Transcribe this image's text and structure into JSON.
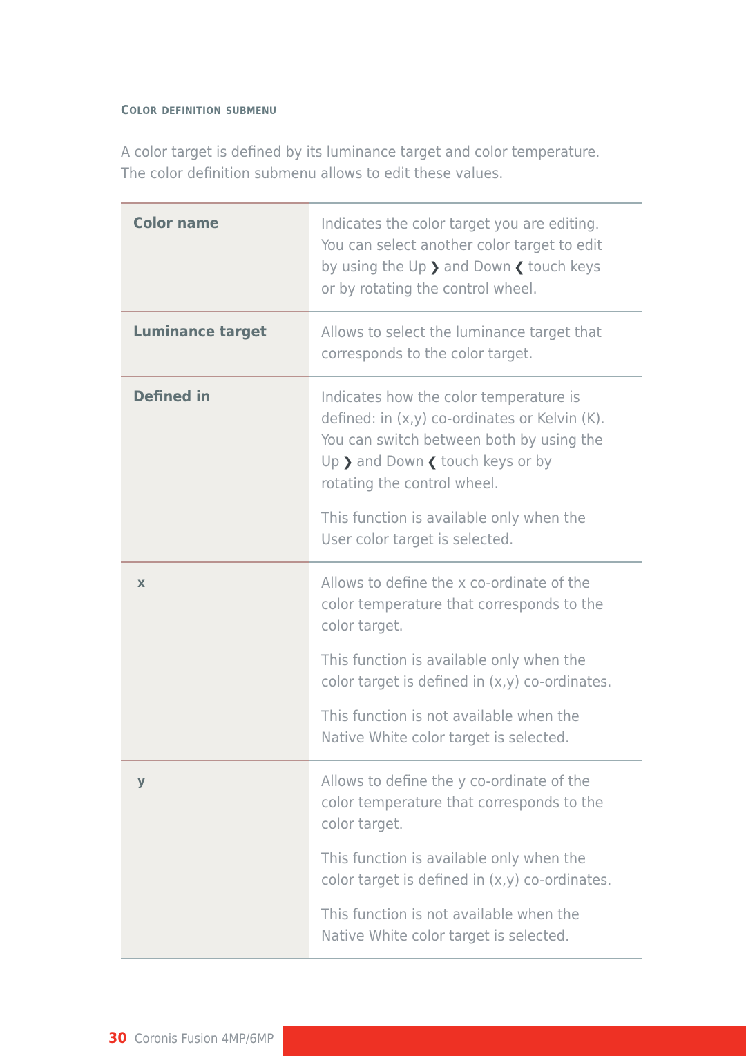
{
  "heading": "Color definition submenu",
  "intro": {
    "lines": [
      "A color target is defined by its luminance target and color temperature.",
      "The color definition submenu allows to edit these values."
    ]
  },
  "glyphs": {
    "up_key": "❯",
    "down_key": "❮"
  },
  "table": {
    "rows": [
      {
        "label": "Color name",
        "paragraphs": [
          {
            "lines": [
              {
                "segments": [
                  {
                    "text": "Indicates the color target you are editing."
                  }
                ]
              },
              {
                "segments": [
                  {
                    "text": "You can select another color target to edit"
                  }
                ]
              },
              {
                "segments": [
                  {
                    "text": "by using the Up"
                  },
                  {
                    "key": "❯"
                  },
                  {
                    "text": "and Down"
                  },
                  {
                    "key": "❮"
                  },
                  {
                    "text": "touch keys"
                  }
                ]
              },
              {
                "segments": [
                  {
                    "text": "or by rotating the control wheel."
                  }
                ]
              }
            ]
          }
        ]
      },
      {
        "label": "Luminance target",
        "paragraphs": [
          {
            "lines": [
              {
                "segments": [
                  {
                    "text": "Allows to select the luminance target that"
                  }
                ]
              },
              {
                "segments": [
                  {
                    "text": "corresponds to the color target."
                  }
                ]
              }
            ]
          }
        ]
      },
      {
        "label": "Defined in",
        "paragraphs": [
          {
            "lines": [
              {
                "segments": [
                  {
                    "text": "Indicates how the color temperature is"
                  }
                ]
              },
              {
                "segments": [
                  {
                    "text": "defined: in (x,y) co-ordinates or Kelvin (K)."
                  }
                ]
              },
              {
                "segments": [
                  {
                    "text": "You can switch between both by using the"
                  }
                ]
              },
              {
                "segments": [
                  {
                    "text": "Up"
                  },
                  {
                    "key": "❯"
                  },
                  {
                    "text": "and Down"
                  },
                  {
                    "key": "❮"
                  },
                  {
                    "text": "touch keys or by"
                  }
                ]
              },
              {
                "segments": [
                  {
                    "text": "rotating the control wheel."
                  }
                ]
              }
            ]
          },
          {
            "lines": [
              {
                "segments": [
                  {
                    "text": "This function is available only when the"
                  }
                ]
              },
              {
                "segments": [
                  {
                    "text": "User color target is selected."
                  }
                ]
              }
            ]
          }
        ]
      },
      {
        "label": "x",
        "label_style": "plain",
        "paragraphs": [
          {
            "lines": [
              {
                "segments": [
                  {
                    "text": "Allows to define the x co-ordinate of the"
                  }
                ]
              },
              {
                "segments": [
                  {
                    "text": "color temperature that corresponds to the"
                  }
                ]
              },
              {
                "segments": [
                  {
                    "text": "color target."
                  }
                ]
              }
            ]
          },
          {
            "lines": [
              {
                "segments": [
                  {
                    "text": "This function is available only when the"
                  }
                ]
              },
              {
                "segments": [
                  {
                    "text": "color target is defined in (x,y) co-ordinates."
                  }
                ]
              }
            ]
          },
          {
            "lines": [
              {
                "segments": [
                  {
                    "text": "This function is not available when the"
                  }
                ]
              },
              {
                "segments": [
                  {
                    "text": "Native White color target is selected."
                  }
                ]
              }
            ]
          }
        ]
      },
      {
        "label": "y",
        "label_style": "plain",
        "paragraphs": [
          {
            "lines": [
              {
                "segments": [
                  {
                    "text": "Allows to define the y co-ordinate of the"
                  }
                ]
              },
              {
                "segments": [
                  {
                    "text": "color temperature that corresponds to the"
                  }
                ]
              },
              {
                "segments": [
                  {
                    "text": "color target."
                  }
                ]
              }
            ]
          },
          {
            "lines": [
              {
                "segments": [
                  {
                    "text": "This function is available only when the"
                  }
                ]
              },
              {
                "segments": [
                  {
                    "text": "color target is defined in (x,y) co-ordinates."
                  }
                ]
              }
            ]
          },
          {
            "lines": [
              {
                "segments": [
                  {
                    "text": "This function is not available when the"
                  }
                ]
              },
              {
                "segments": [
                  {
                    "text": "Native White color target is selected."
                  }
                ]
              }
            ]
          }
        ]
      }
    ]
  },
  "footer": {
    "page_number": "30",
    "document_title": "Coronis Fusion 4MP/6MP"
  },
  "colors": {
    "brand_red": "#ee3124",
    "heading_slate": "#667a80",
    "body_gray": "#8e959c",
    "label_slate": "#5f7074",
    "cell_bg": "#efeeea",
    "rule_rose": "#b9928f",
    "rule_blue": "#9badb2"
  }
}
